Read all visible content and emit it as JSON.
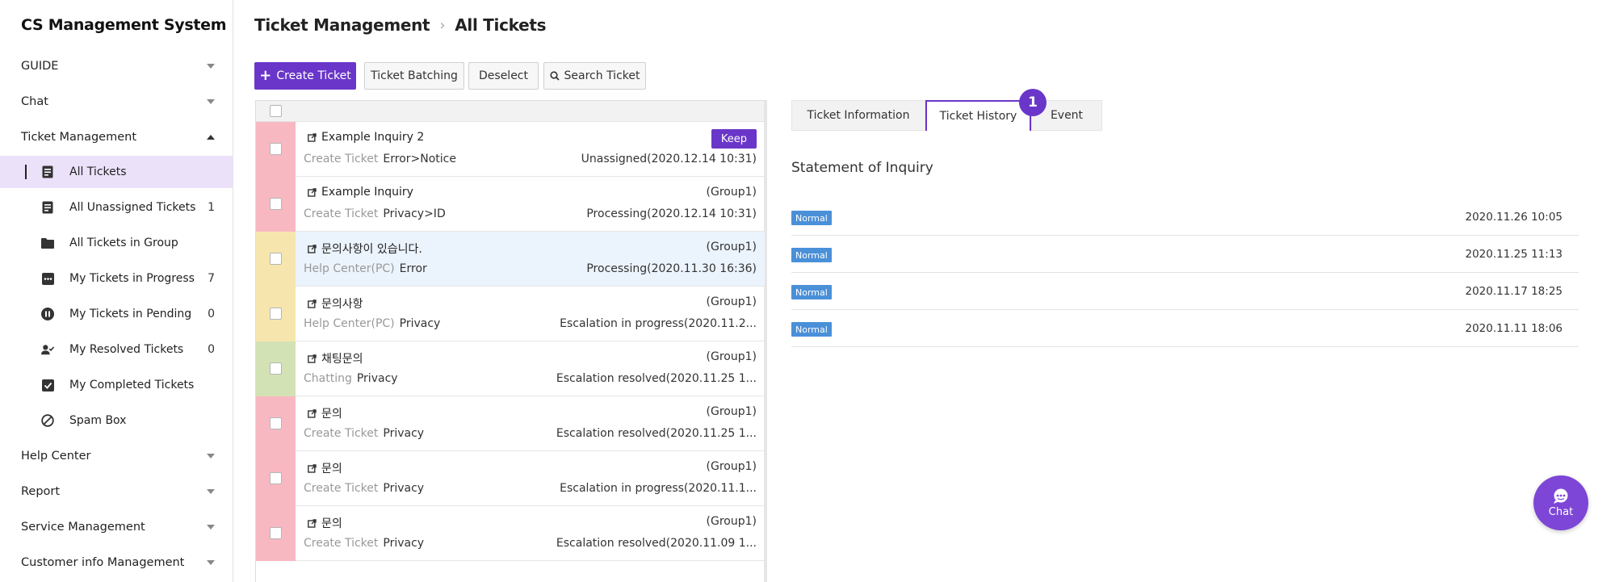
{
  "app": {
    "title": "CS Management System"
  },
  "sidebar": {
    "sections": [
      {
        "label": "GUIDE",
        "expanded": false
      },
      {
        "label": "Chat",
        "expanded": false
      },
      {
        "label": "Ticket Management",
        "expanded": true
      },
      {
        "label": "Help Center",
        "expanded": false
      },
      {
        "label": "Report",
        "expanded": false
      },
      {
        "label": "Service Management",
        "expanded": false
      },
      {
        "label": "Customer info Management",
        "expanded": false
      }
    ],
    "ticket_items": [
      {
        "label": "All Tickets",
        "count": "",
        "icon": "ticket-doc-icon",
        "active": true
      },
      {
        "label": "All Unassigned Tickets",
        "count": "1",
        "icon": "ticket-lines-icon"
      },
      {
        "label": "All Tickets in Group",
        "count": "",
        "icon": "folder-icon"
      },
      {
        "label": "My Tickets in Progress",
        "count": "7",
        "icon": "progress-dots-icon"
      },
      {
        "label": "My Tickets in Pending",
        "count": "0",
        "icon": "pause-icon"
      },
      {
        "label": "My Resolved Tickets",
        "count": "0",
        "icon": "user-check-icon"
      },
      {
        "label": "My Completed Tickets",
        "count": "",
        "icon": "checkbox-icon"
      },
      {
        "label": "Spam Box",
        "count": "",
        "icon": "block-icon"
      }
    ]
  },
  "header": {
    "breadcrumb_root": "Ticket Management",
    "breadcrumb_current": "All Tickets"
  },
  "toolbar": {
    "create": "Create Ticket",
    "batching": "Ticket Batching",
    "deselect": "Deselect",
    "search": "Search Ticket"
  },
  "tickets": [
    {
      "title": "Example Inquiry 2",
      "source": "Create Ticket",
      "category": "Error>Notice",
      "group": "",
      "status": "Unassigned(2020.12.14 10:31)",
      "keep": "Keep",
      "color": "#f8b8c2"
    },
    {
      "title": "Example Inquiry",
      "source": "Create Ticket",
      "category": "Privacy>ID",
      "group": "(Group1)",
      "status": "Processing(2020.12.14 10:31)",
      "color": "#f8b8c2"
    },
    {
      "title": "문의사항이 있습니다.",
      "source": "Help Center(PC)",
      "category": "Error",
      "group": "(Group1)",
      "status": "Processing(2020.11.30 16:36)",
      "color": "#f6e6ae",
      "selected": true
    },
    {
      "title": "문의사항",
      "source": "Help Center(PC)",
      "category": "Privacy",
      "group": "(Group1)",
      "status": "Escalation in progress(2020.11.2...",
      "color": "#f6e6ae"
    },
    {
      "title": "채팅문의",
      "source": "Chatting",
      "category": "Privacy",
      "group": "(Group1)",
      "status": "Escalation resolved(2020.11.25 1...",
      "color": "#d3e2b4"
    },
    {
      "title": "문의",
      "source": "Create Ticket",
      "category": "Privacy",
      "group": "(Group1)",
      "status": "Escalation resolved(2020.11.25 1...",
      "color": "#f8b8c2"
    },
    {
      "title": "문의",
      "source": "Create Ticket",
      "category": "Privacy",
      "group": "(Group1)",
      "status": "Escalation in progress(2020.11.1...",
      "color": "#f8b8c2"
    },
    {
      "title": "문의",
      "source": "Create Ticket",
      "category": "Privacy",
      "group": "(Group1)",
      "status": "Escalation resolved(2020.11.09 1...",
      "color": "#f8b8c2"
    }
  ],
  "detail": {
    "tabs": [
      "Ticket Information",
      "Ticket History",
      "Event"
    ],
    "active_tab": "Ticket History",
    "step_badge": "1",
    "section_title": "Statement of Inquiry",
    "history": [
      {
        "badge": "Normal",
        "date": "2020.11.26 10:05"
      },
      {
        "badge": "Normal",
        "date": "2020.11.25 11:13"
      },
      {
        "badge": "Normal",
        "date": "2020.11.17 18:25"
      },
      {
        "badge": "Normal",
        "date": "2020.11.11 18:06"
      }
    ]
  },
  "chat_button": {
    "label": "Chat"
  }
}
